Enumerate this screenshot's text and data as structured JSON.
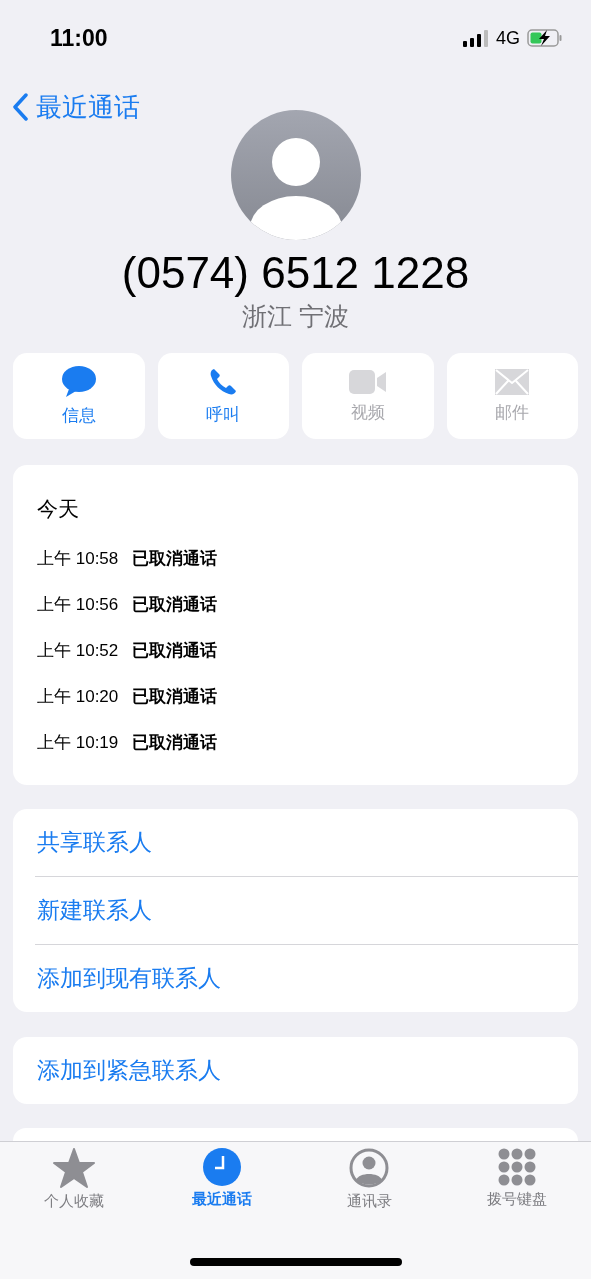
{
  "status_bar": {
    "time": "11:00",
    "network": "4G"
  },
  "nav": {
    "back_label": "最近通话"
  },
  "contact": {
    "number": "(0574) 6512 1228",
    "location": "浙江 宁波"
  },
  "actions": [
    {
      "kind": "message",
      "label": "信息",
      "enabled": true
    },
    {
      "kind": "call",
      "label": "呼叫",
      "enabled": true
    },
    {
      "kind": "video",
      "label": "视频",
      "enabled": false
    },
    {
      "kind": "mail",
      "label": "邮件",
      "enabled": false
    }
  ],
  "call_log": {
    "heading": "今天",
    "entries": [
      {
        "time": "上午 10:58",
        "status": "已取消通话"
      },
      {
        "time": "上午 10:56",
        "status": "已取消通话"
      },
      {
        "time": "上午 10:52",
        "status": "已取消通话"
      },
      {
        "time": "上午 10:20",
        "status": "已取消通话"
      },
      {
        "time": "上午 10:19",
        "status": "已取消通话"
      }
    ]
  },
  "contact_options": [
    "共享联系人",
    "新建联系人",
    "添加到现有联系人"
  ],
  "emergency_option": "添加到紧急联系人",
  "tab_bar": [
    {
      "kind": "favorites",
      "label": "个人收藏",
      "selected": false
    },
    {
      "kind": "recents",
      "label": "最近通话",
      "selected": true
    },
    {
      "kind": "contacts",
      "label": "通讯录",
      "selected": false
    },
    {
      "kind": "keypad",
      "label": "拨号键盘",
      "selected": false
    }
  ]
}
